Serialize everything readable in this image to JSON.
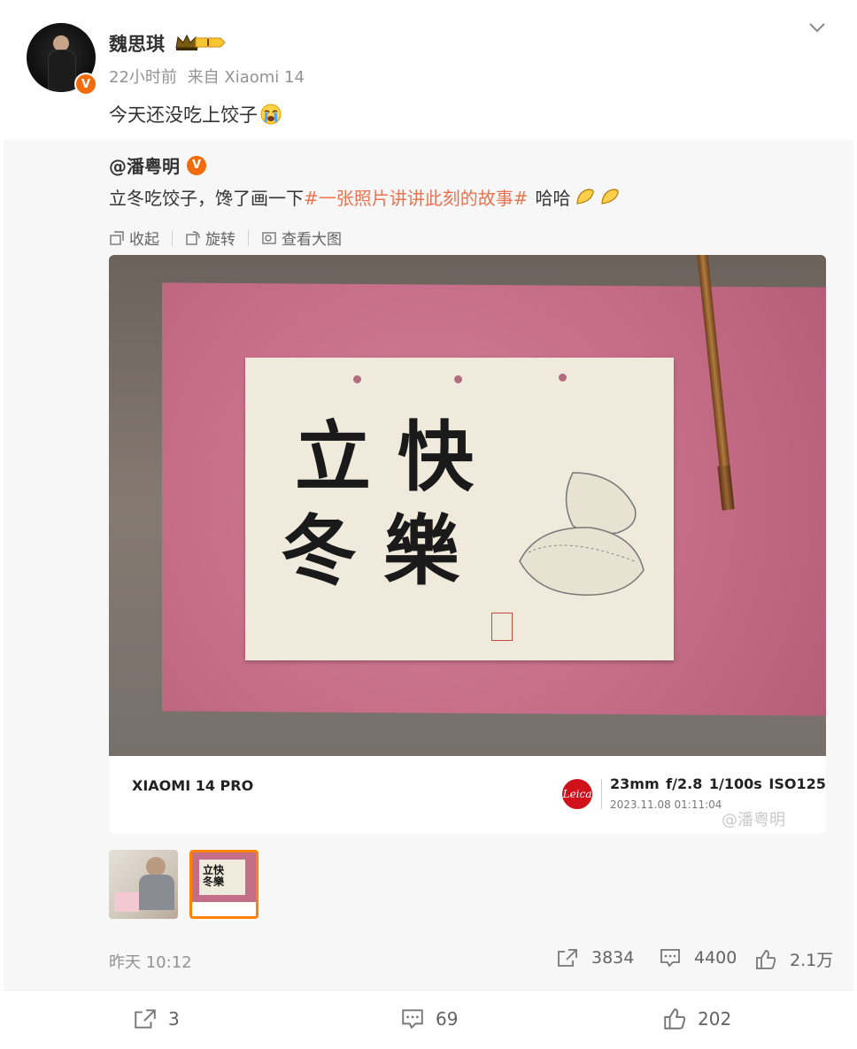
{
  "post": {
    "author": "魏思琪",
    "level_badge": "I",
    "time": "22小时前",
    "source": "来自 Xiaomi 14",
    "text": "今天还没吃上饺子",
    "emoji": "crying-face-icon"
  },
  "repost": {
    "author": "@潘粤明",
    "text_before": "立冬吃饺子，馋了画一下",
    "topic": "#一张照片讲讲此刻的故事#",
    "text_after": "哈哈",
    "emojis": [
      "dumpling-icon",
      "dumpling-icon"
    ],
    "image_actions": [
      {
        "label": "收起",
        "icon": "collapse-icon"
      },
      {
        "label": "旋转",
        "icon": "rotate-icon"
      },
      {
        "label": "查看大图",
        "icon": "view-large-icon"
      }
    ],
    "photo": {
      "calligraphy_top": "立 快",
      "calligraphy_bottom": "冬 樂",
      "watermark_model": "XIAOMI 14 PRO",
      "watermark_brand": "Leica",
      "watermark_specs": "23mm  f/2.8  1/100s  ISO125",
      "watermark_datetime": "2023.11.08  01:11:04",
      "watermark_owner": "@潘粤明"
    },
    "time": "昨天 10:12",
    "stats": {
      "reposts": "3834",
      "comments": "4400",
      "likes": "2.1万"
    }
  },
  "actions": {
    "reposts": "3",
    "comments": "69",
    "likes": "202"
  },
  "colors": {
    "accent": "#ff8200",
    "topic": "#eb7350",
    "verified": "#f26c0d"
  }
}
